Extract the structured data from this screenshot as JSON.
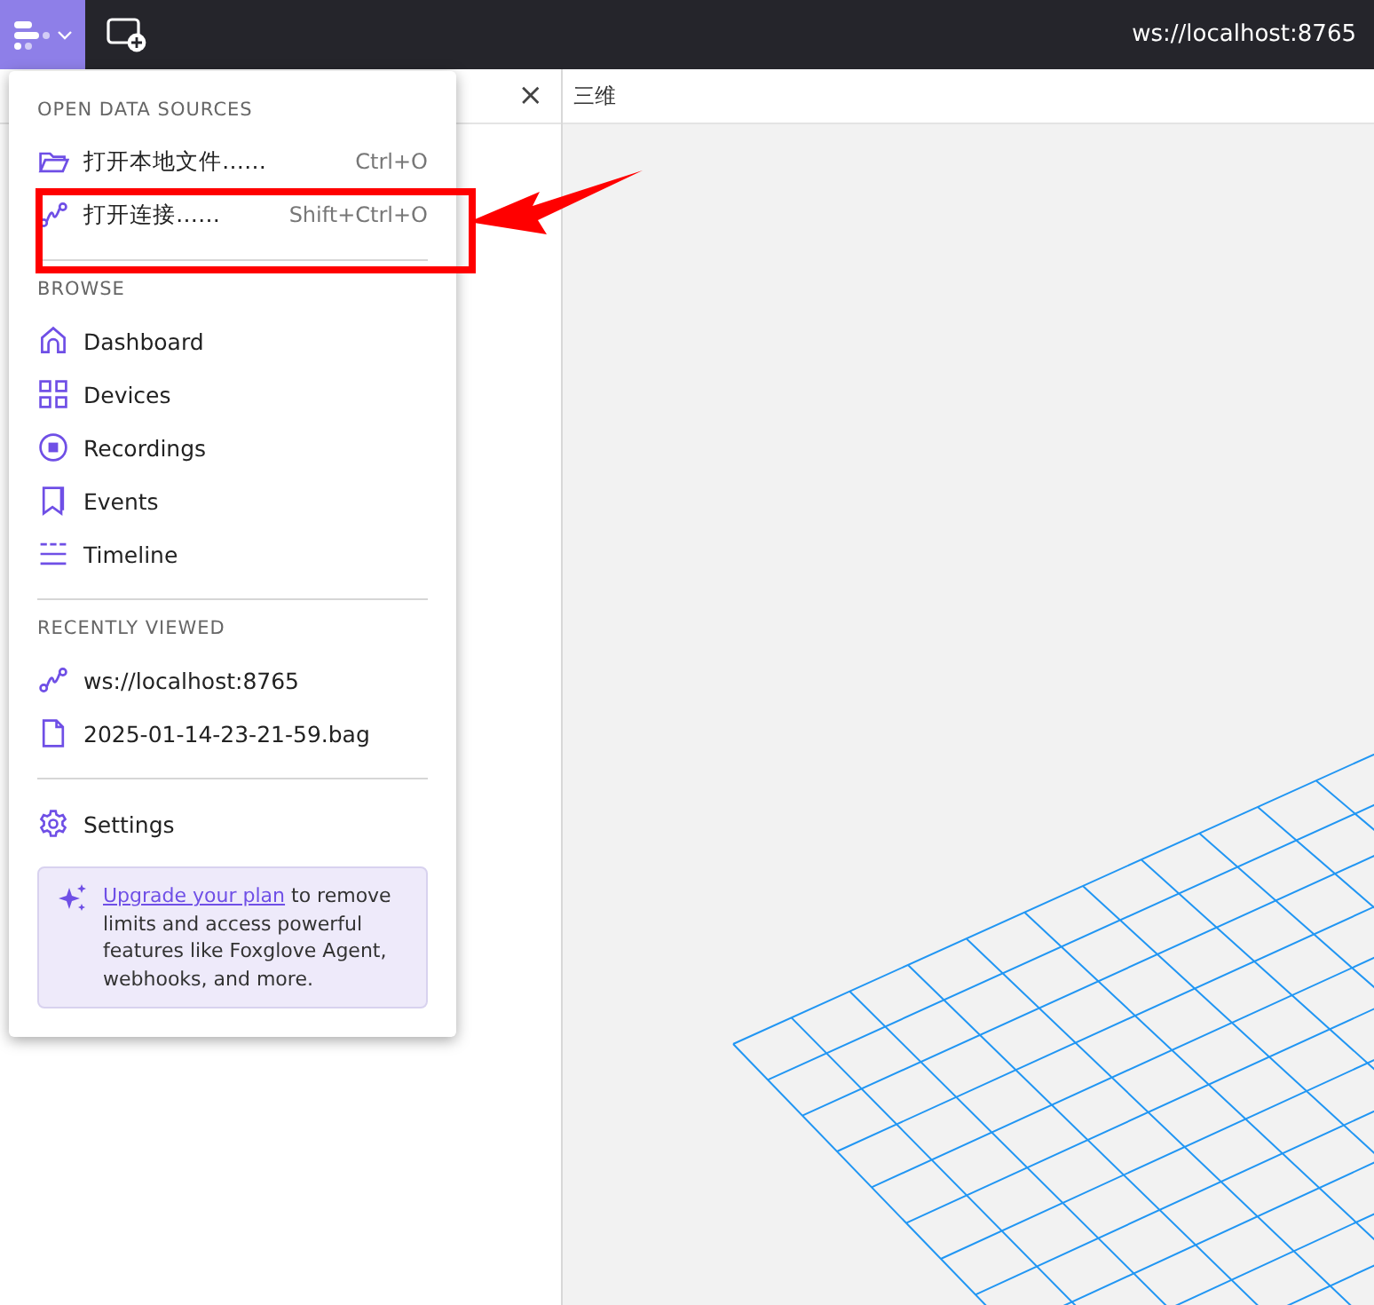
{
  "top_bar": {
    "connection": "ws://localhost:8765"
  },
  "panel": {
    "title": "三维",
    "close": "×"
  },
  "menu": {
    "sections": [
      {
        "heading": "OPEN DATA SOURCES",
        "items": [
          {
            "kind": "folder",
            "label": "打开本地文件……",
            "shortcut": "Ctrl+O"
          },
          {
            "kind": "connection",
            "label": "打开连接……",
            "shortcut": "Shift+Ctrl+O"
          }
        ]
      },
      {
        "heading": "BROWSE",
        "items": [
          {
            "kind": "home",
            "label": "Dashboard"
          },
          {
            "kind": "grid",
            "label": "Devices"
          },
          {
            "kind": "record",
            "label": "Recordings"
          },
          {
            "kind": "bookmark",
            "label": "Events"
          },
          {
            "kind": "timeline",
            "label": "Timeline"
          }
        ]
      },
      {
        "heading": "RECENTLY VIEWED",
        "items": [
          {
            "kind": "connection",
            "label": "ws://localhost:8765"
          },
          {
            "kind": "file",
            "label": "2025-01-14-23-21-59.bag"
          }
        ]
      },
      {
        "items": [
          {
            "kind": "gear",
            "label": "Settings"
          }
        ]
      }
    ],
    "upgrade": {
      "link": "Upgrade your plan",
      "text": " to remove limits and access powerful features like Foxglove Agent, webhooks, and more."
    }
  }
}
